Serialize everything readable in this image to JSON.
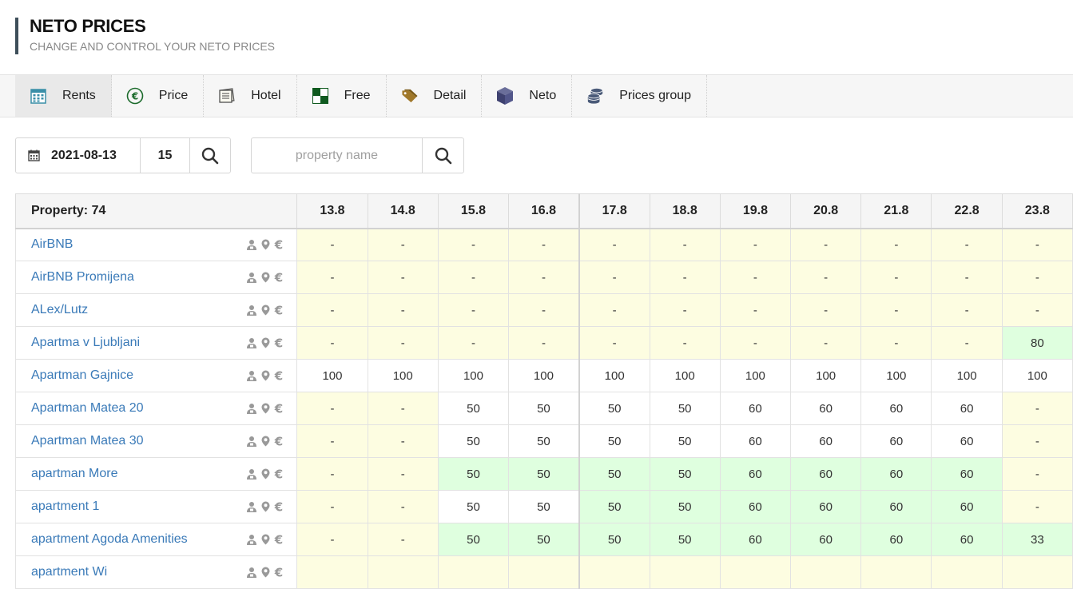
{
  "header": {
    "title": "NETO PRICES",
    "subtitle": "CHANGE AND CONTROL YOUR NETO PRICES"
  },
  "tabs": [
    {
      "label": "Rents",
      "icon": "calendar-icon",
      "active": true
    },
    {
      "label": "Price",
      "icon": "euro-icon"
    },
    {
      "label": "Hotel",
      "icon": "notebook-icon"
    },
    {
      "label": "Free",
      "icon": "checker-icon"
    },
    {
      "label": "Detail",
      "icon": "tag-icon"
    },
    {
      "label": "Neto",
      "icon": "cube-icon"
    },
    {
      "label": "Prices group",
      "icon": "coins-icon"
    }
  ],
  "filters": {
    "date": "2021-08-13",
    "days": "15",
    "search_placeholder": "property name",
    "search_value": ""
  },
  "table": {
    "property_header": "Property: 74",
    "dates": [
      "13.8",
      "14.8",
      "15.8",
      "16.8",
      "17.8",
      "18.8",
      "19.8",
      "20.8",
      "21.8",
      "22.8",
      "23.8"
    ],
    "rows": [
      {
        "name": "AirBNB",
        "values": [
          "-",
          "-",
          "-",
          "-",
          "-",
          "-",
          "-",
          "-",
          "-",
          "-",
          "-"
        ],
        "colors": [
          "y",
          "y",
          "y",
          "y",
          "y",
          "y",
          "y",
          "y",
          "y",
          "y",
          "y"
        ]
      },
      {
        "name": "AirBNB Promijena",
        "values": [
          "-",
          "-",
          "-",
          "-",
          "-",
          "-",
          "-",
          "-",
          "-",
          "-",
          "-"
        ],
        "colors": [
          "y",
          "y",
          "y",
          "y",
          "y",
          "y",
          "y",
          "y",
          "y",
          "y",
          "y"
        ]
      },
      {
        "name": "ALex/Lutz",
        "values": [
          "-",
          "-",
          "-",
          "-",
          "-",
          "-",
          "-",
          "-",
          "-",
          "-",
          "-"
        ],
        "colors": [
          "y",
          "y",
          "y",
          "y",
          "y",
          "y",
          "y",
          "y",
          "y",
          "y",
          "y"
        ]
      },
      {
        "name": "Apartma v Ljubljani",
        "values": [
          "-",
          "-",
          "-",
          "-",
          "-",
          "-",
          "-",
          "-",
          "-",
          "-",
          "80"
        ],
        "colors": [
          "y",
          "y",
          "y",
          "y",
          "y",
          "y",
          "y",
          "y",
          "y",
          "y",
          "g"
        ]
      },
      {
        "name": "Apartman Gajnice",
        "values": [
          "100",
          "100",
          "100",
          "100",
          "100",
          "100",
          "100",
          "100",
          "100",
          "100",
          "100"
        ],
        "colors": [
          "w",
          "w",
          "w",
          "w",
          "w",
          "w",
          "w",
          "w",
          "w",
          "w",
          "w"
        ]
      },
      {
        "name": "Apartman Matea 20",
        "values": [
          "-",
          "-",
          "50",
          "50",
          "50",
          "50",
          "60",
          "60",
          "60",
          "60",
          "-"
        ],
        "colors": [
          "y",
          "y",
          "w",
          "w",
          "w",
          "w",
          "w",
          "w",
          "w",
          "w",
          "y"
        ]
      },
      {
        "name": "Apartman Matea 30",
        "values": [
          "-",
          "-",
          "50",
          "50",
          "50",
          "50",
          "60",
          "60",
          "60",
          "60",
          "-"
        ],
        "colors": [
          "y",
          "y",
          "w",
          "w",
          "w",
          "w",
          "w",
          "w",
          "w",
          "w",
          "y"
        ]
      },
      {
        "name": "apartman More",
        "values": [
          "-",
          "-",
          "50",
          "50",
          "50",
          "50",
          "60",
          "60",
          "60",
          "60",
          "-"
        ],
        "colors": [
          "y",
          "y",
          "g",
          "g",
          "g",
          "g",
          "g",
          "g",
          "g",
          "g",
          "y"
        ]
      },
      {
        "name": "apartment 1",
        "values": [
          "-",
          "-",
          "50",
          "50",
          "50",
          "50",
          "60",
          "60",
          "60",
          "60",
          "-"
        ],
        "colors": [
          "y",
          "y",
          "w",
          "w",
          "g",
          "g",
          "g",
          "g",
          "g",
          "g",
          "y"
        ]
      },
      {
        "name": "apartment Agoda Amenities",
        "values": [
          "-",
          "-",
          "50",
          "50",
          "50",
          "50",
          "60",
          "60",
          "60",
          "60",
          "33"
        ],
        "colors": [
          "y",
          "y",
          "g",
          "g",
          "g",
          "g",
          "g",
          "g",
          "g",
          "g",
          "g"
        ]
      },
      {
        "name": "apartment Wi",
        "values": [
          "",
          "",
          "",
          "",
          "",
          "",
          "",
          "",
          "",
          "",
          ""
        ],
        "colors": [
          "y",
          "y",
          "y",
          "y",
          "y",
          "y",
          "y",
          "y",
          "y",
          "y",
          "y"
        ]
      }
    ]
  },
  "colors": {
    "link": "#3a7ab8",
    "empty_cell": "#fdfde1",
    "set_cell": "#dfffdf",
    "header_bar": "#3e4f5a"
  }
}
